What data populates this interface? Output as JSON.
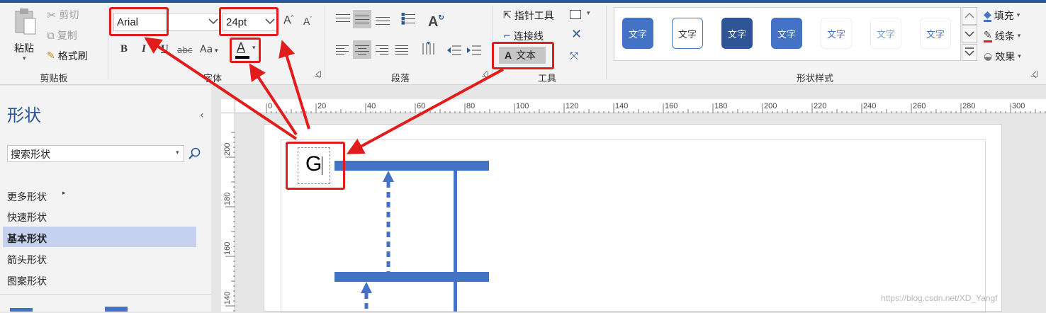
{
  "clipboard": {
    "paste_label": "粘贴",
    "cut_label": "剪切",
    "copy_label": "复制",
    "format_painter_label": "格式刷",
    "group_label": "剪贴板"
  },
  "font": {
    "font_name": "Arial",
    "font_size": "24pt",
    "grow_label": "A",
    "shrink_label": "A",
    "bold_label": "B",
    "italic_label": "I",
    "underline_label": "U",
    "strike_label": "abc",
    "case_label": "Aa",
    "color_label": "A",
    "group_label": "字体"
  },
  "paragraph": {
    "text_direction_label": "A",
    "group_label": "段落"
  },
  "tools": {
    "pointer_label": "指针工具",
    "connector_label": "连接线",
    "text_label": "文本",
    "group_label": "工具"
  },
  "shape_styles": {
    "items": [
      "文字",
      "文字",
      "文字",
      "文字",
      "文字",
      "文字",
      "文字"
    ],
    "fill_label": "填充",
    "line_label": "线条",
    "effect_label": "效果",
    "group_label": "形状样式"
  },
  "shapes_panel": {
    "title": "形状",
    "search_placeholder": "搜索形状",
    "menu": [
      "更多形状",
      "快速形状",
      "基本形状",
      "箭头形状",
      "图案形状"
    ]
  },
  "ruler": {
    "h_ticks": [
      "0",
      "20",
      "40",
      "60",
      "80",
      "100",
      "120",
      "140",
      "160",
      "180",
      "200",
      "220",
      "240",
      "260",
      "280",
      "300"
    ],
    "v_ticks": [
      "200",
      "180",
      "160",
      "140"
    ]
  },
  "canvas": {
    "text_box_content": "G"
  },
  "watermark": "https://blog.csdn.net/XD_Yangf",
  "colors": {
    "accent": "#2b579a",
    "diagram": "#4472c4",
    "highlight": "#e21b1b",
    "selected": "#c5d1ef"
  }
}
